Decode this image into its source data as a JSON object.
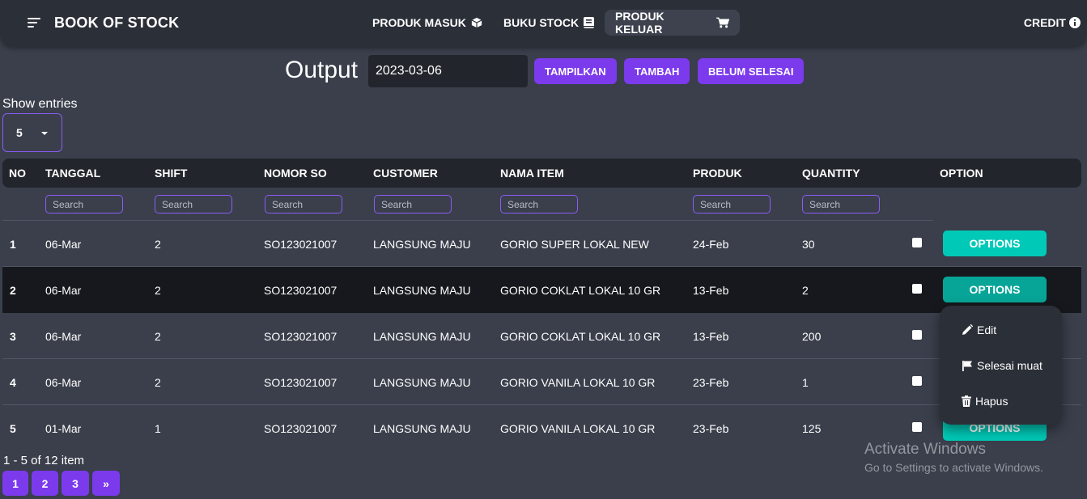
{
  "app": {
    "title": "BOOK OF STOCK"
  },
  "nav": {
    "items": [
      {
        "label": "PRODUK MASUK",
        "icon": "cube-icon"
      },
      {
        "label": "BUKU STOCK",
        "icon": "book-icon"
      },
      {
        "label": "PRODUK KELUAR",
        "icon": "cart-icon",
        "active": true
      }
    ],
    "credit": {
      "label": "CREDIT",
      "icon": "info-icon"
    }
  },
  "toolbar": {
    "heading": "Output",
    "date_value": "2023-03-06",
    "buttons": [
      "TAMPILKAN",
      "TAMBAH",
      "BELUM SELESAI"
    ]
  },
  "entries": {
    "label": "Show entries",
    "value": "5"
  },
  "table": {
    "columns": [
      "NO",
      "TANGGAL",
      "SHIFT",
      "NOMOR SO",
      "CUSTOMER",
      "NAMA ITEM",
      "PRODUK",
      "QUANTITY",
      "OPTION"
    ],
    "search_placeholder": "Search",
    "option_label": "OPTIONS",
    "rows": [
      {
        "no": "1",
        "tanggal": "06-Mar",
        "shift": "2",
        "nomor_so": "SO123021007",
        "customer": "LANGSUNG MAJU",
        "nama_item": "GORIO SUPER LOKAL NEW",
        "produk": "24-Feb",
        "quantity": "30"
      },
      {
        "no": "2",
        "tanggal": "06-Mar",
        "shift": "2",
        "nomor_so": "SO123021007",
        "customer": "LANGSUNG MAJU",
        "nama_item": "GORIO COKLAT LOKAL 10 GR",
        "produk": "13-Feb",
        "quantity": "2"
      },
      {
        "no": "3",
        "tanggal": "06-Mar",
        "shift": "2",
        "nomor_so": "SO123021007",
        "customer": "LANGSUNG MAJU",
        "nama_item": "GORIO COKLAT LOKAL 10 GR",
        "produk": "13-Feb",
        "quantity": "200"
      },
      {
        "no": "4",
        "tanggal": "06-Mar",
        "shift": "2",
        "nomor_so": "SO123021007",
        "customer": "LANGSUNG MAJU",
        "nama_item": "GORIO VANILA LOKAL 10 GR",
        "produk": "23-Feb",
        "quantity": "1"
      },
      {
        "no": "5",
        "tanggal": "01-Mar",
        "shift": "1",
        "nomor_so": "SO123021007",
        "customer": "LANGSUNG MAJU",
        "nama_item": "GORIO VANILA LOKAL 10 GR",
        "produk": "23-Feb",
        "quantity": "125"
      }
    ]
  },
  "dropdown": {
    "items": [
      {
        "label": "Edit",
        "icon": "pencil-icon"
      },
      {
        "label": "Selesai muat",
        "icon": "flag-icon"
      },
      {
        "label": "Hapus",
        "icon": "trash-icon"
      }
    ]
  },
  "pagination": {
    "summary": "1 - 5 of 12 item",
    "pages": [
      "1",
      "2",
      "3",
      "»"
    ]
  },
  "watermark": {
    "line1": "Activate Windows",
    "line2": "Go to Settings to activate Windows."
  },
  "colors": {
    "background": "#3a3f4b",
    "navbar": "#2b2f38",
    "accent_purple": "#7c3aed",
    "options_teal": "#00c9b7"
  }
}
